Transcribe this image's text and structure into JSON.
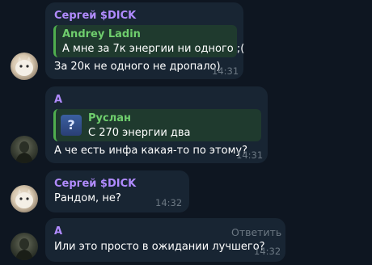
{
  "messages": [
    {
      "sender": "Сергей $DICK",
      "quote": {
        "name": "Andrey Ladin",
        "text": "А мне за 7к энергии ни одного ;("
      },
      "text": "За 20к не одного не дропало)",
      "time": "14:31"
    },
    {
      "sender": "A",
      "quote": {
        "name": "Руслан",
        "text": "С 270 энергии два",
        "thumb": "?"
      },
      "text": "А че есть инфа какая-то по этому?",
      "time": "14:31"
    },
    {
      "sender": "Сергей $DICK",
      "text": "Рандом, не?",
      "time": "14:32"
    },
    {
      "sender": "A",
      "text": "Или это просто в ожидании лучшего?",
      "time": "14:32",
      "reply_label": "Ответить"
    }
  ],
  "colors": {
    "background": "#0e1621",
    "bubble": "#182533",
    "sender": "#b18bff",
    "quote_accent": "#4fae4e",
    "quote_name": "#6fce6d",
    "time": "#6c7883"
  }
}
